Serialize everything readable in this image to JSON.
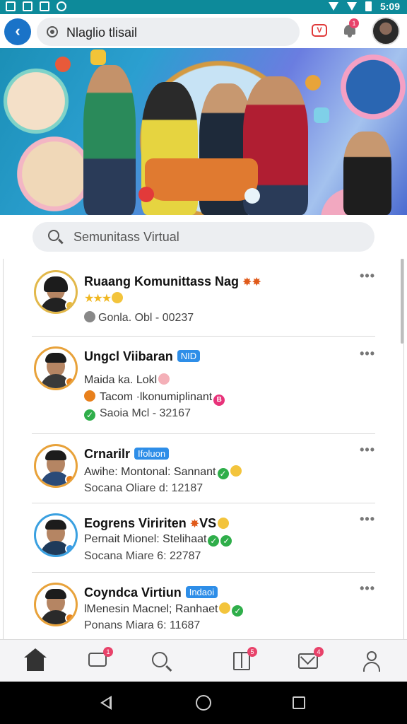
{
  "status_bar": {
    "time": "5:09"
  },
  "app_bar": {
    "url": "Nlaglio tlisail",
    "notification_count": "1",
    "icons": [
      "back-arrow-icon",
      "location-pin-icon",
      "video-icon",
      "bell-icon",
      "profile-avatar"
    ]
  },
  "search": {
    "placeholder": "Semunitass Virtual"
  },
  "communities": [
    {
      "name": "Ruaang Komunittass Nag",
      "stars": "★★★",
      "meta": "Gonla. Obl - 00237"
    },
    {
      "name": "Ungcl Viibaran",
      "tag": "NID",
      "line1": "Maida ka. Lokl",
      "line2": "Tacom ·lkonumiplinant",
      "line2_badge": "B",
      "meta": "Saoia Mcl - 32167"
    },
    {
      "name": "Crnarilr",
      "tag": "Ifoluon",
      "line1": "Awihe: Montonal: Sannant",
      "meta": "Socana Oliare d: 12187"
    },
    {
      "name": "Eogrens Viririten",
      "name_suffix": "VS",
      "line1": "Pernait Mionel: Stelihaat",
      "meta": "Socana Miare 6: 22787"
    },
    {
      "name": "Coyndca Virtiun",
      "tag": "Indaoi",
      "line1": "lMenesin Macnel; Ranhaet",
      "meta": "Ponans Miara 6: 11687"
    }
  ],
  "bottom_nav": {
    "items": [
      "home-icon",
      "chat-icon",
      "search-icon",
      "book-icon",
      "mail-icon",
      "profile-icon"
    ],
    "badges": {
      "chat": "1",
      "book": "5",
      "mail": "4"
    }
  },
  "colors": {
    "status_bar": "#0d8a9a",
    "back_button": "#1a73c8",
    "tag": "#2e8ee8",
    "badge": "#e8426a",
    "verified": "#2fae4a"
  }
}
